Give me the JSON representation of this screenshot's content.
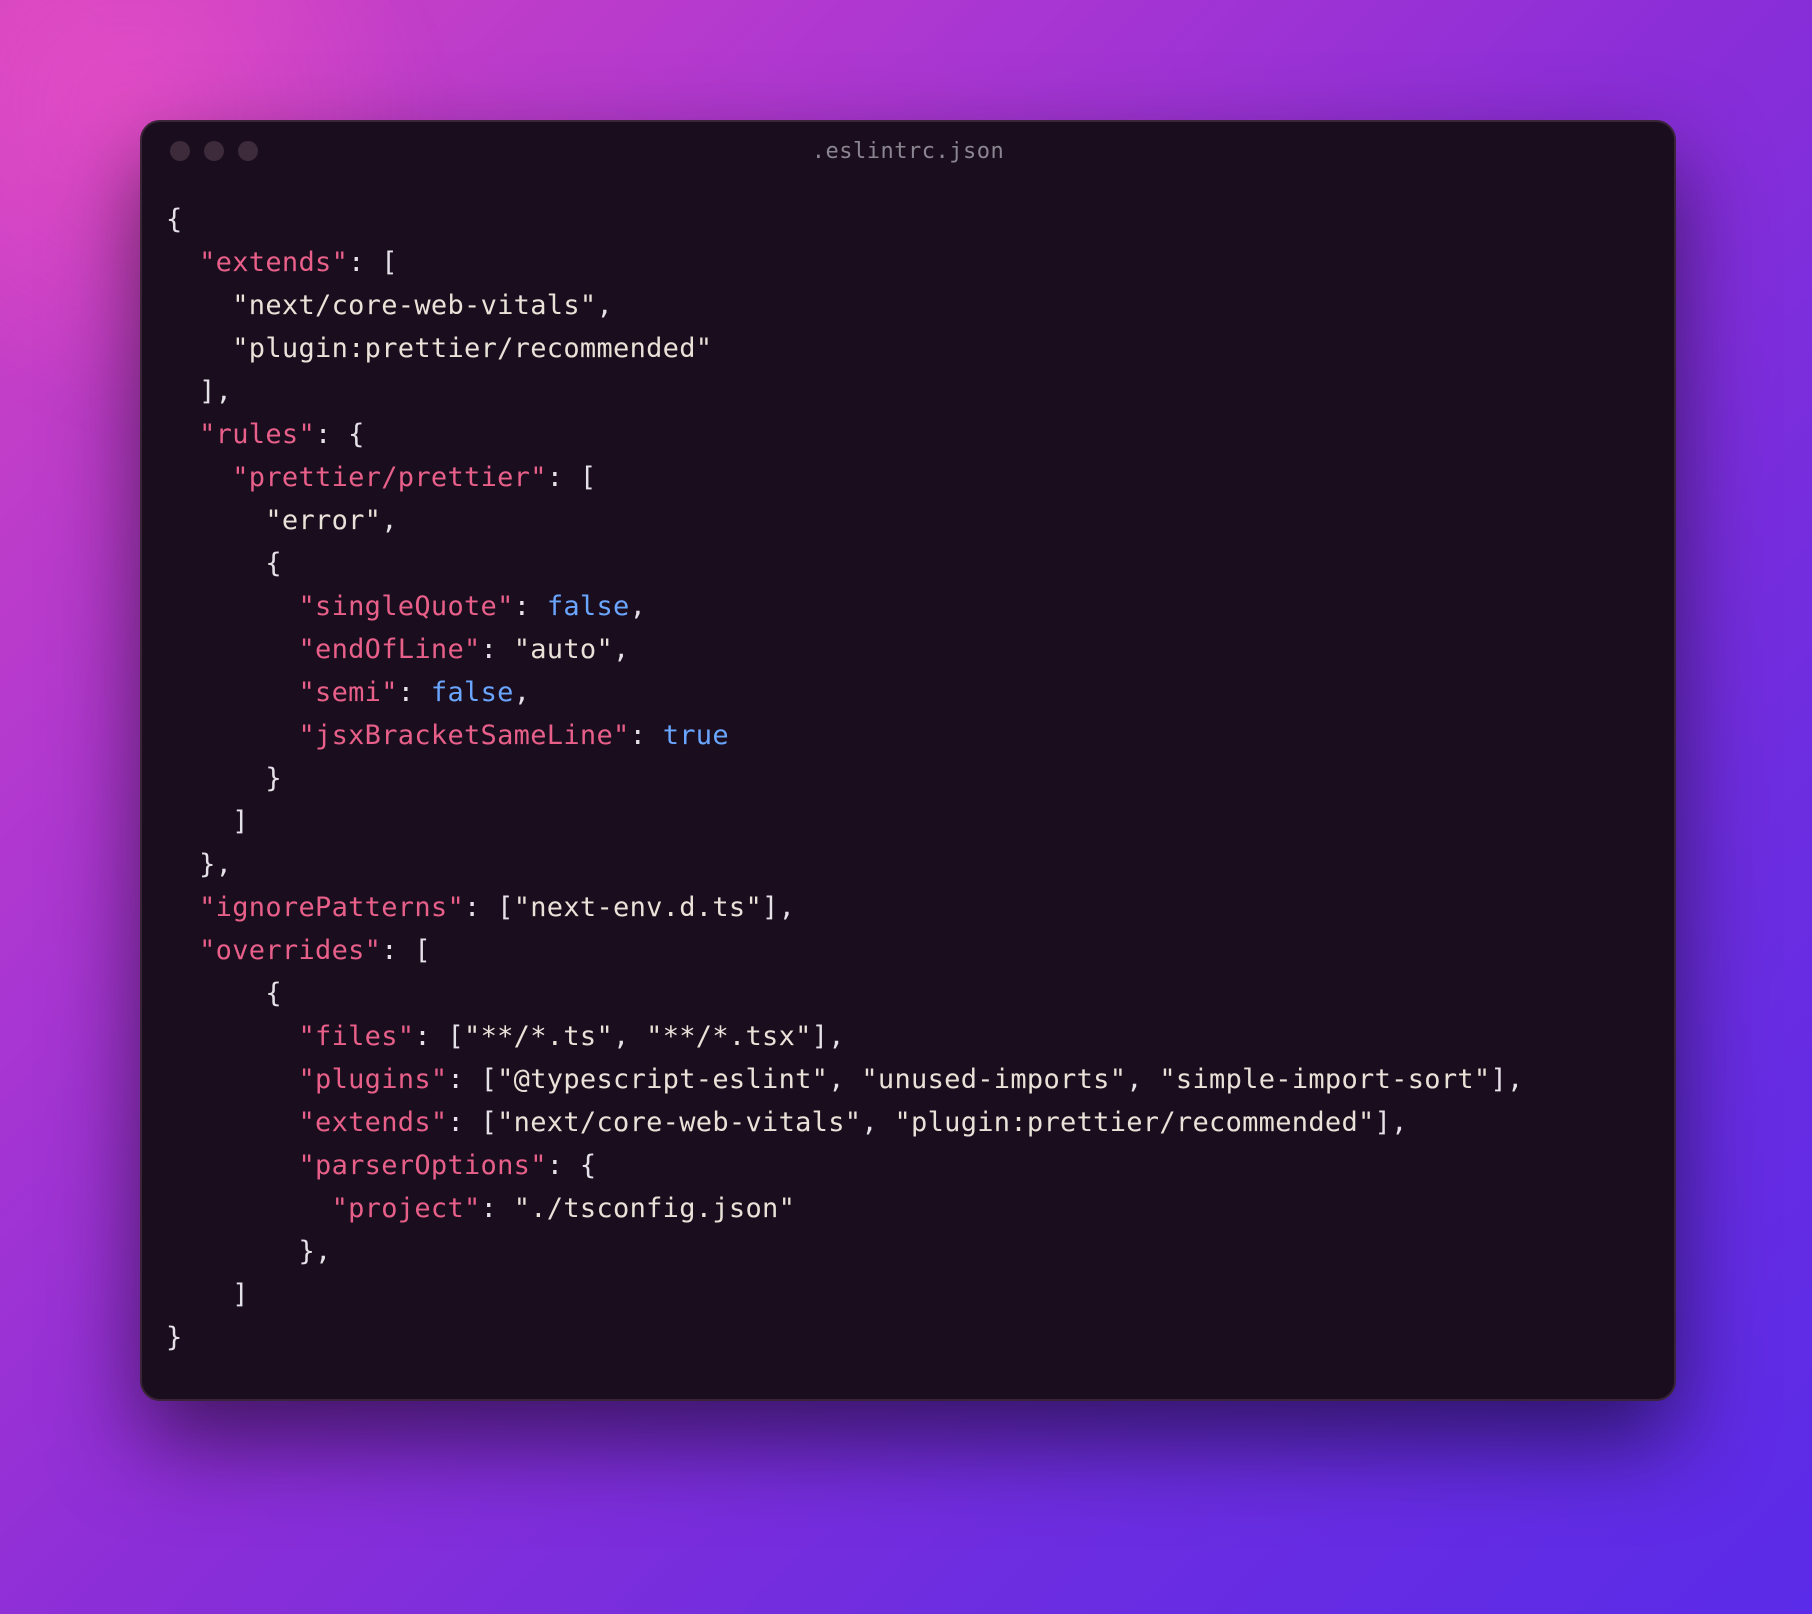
{
  "window": {
    "title": ".eslintrc.json"
  },
  "code": {
    "lines": [
      [
        [
          "punct",
          "{"
        ]
      ],
      [
        [
          "punct",
          "  "
        ],
        [
          "key",
          "\"extends\""
        ],
        [
          "punct",
          ": ["
        ]
      ],
      [
        [
          "punct",
          "    "
        ],
        [
          "str",
          "\"next/core-web-vitals\""
        ],
        [
          "punct",
          ","
        ]
      ],
      [
        [
          "punct",
          "    "
        ],
        [
          "str",
          "\"plugin:prettier/recommended\""
        ]
      ],
      [
        [
          "punct",
          "  ],"
        ]
      ],
      [
        [
          "punct",
          "  "
        ],
        [
          "key",
          "\"rules\""
        ],
        [
          "punct",
          ": {"
        ]
      ],
      [
        [
          "punct",
          "    "
        ],
        [
          "key",
          "\"prettier/prettier\""
        ],
        [
          "punct",
          ": ["
        ]
      ],
      [
        [
          "punct",
          "      "
        ],
        [
          "str",
          "\"error\""
        ],
        [
          "punct",
          ","
        ]
      ],
      [
        [
          "punct",
          "      {"
        ]
      ],
      [
        [
          "punct",
          "        "
        ],
        [
          "key",
          "\"singleQuote\""
        ],
        [
          "punct",
          ": "
        ],
        [
          "bool",
          "false"
        ],
        [
          "punct",
          ","
        ]
      ],
      [
        [
          "punct",
          "        "
        ],
        [
          "key",
          "\"endOfLine\""
        ],
        [
          "punct",
          ": "
        ],
        [
          "str",
          "\"auto\""
        ],
        [
          "punct",
          ","
        ]
      ],
      [
        [
          "punct",
          "        "
        ],
        [
          "key",
          "\"semi\""
        ],
        [
          "punct",
          ": "
        ],
        [
          "bool",
          "false"
        ],
        [
          "punct",
          ","
        ]
      ],
      [
        [
          "punct",
          "        "
        ],
        [
          "key",
          "\"jsxBracketSameLine\""
        ],
        [
          "punct",
          ": "
        ],
        [
          "bool",
          "true"
        ]
      ],
      [
        [
          "punct",
          "      }"
        ]
      ],
      [
        [
          "punct",
          "    ]"
        ]
      ],
      [
        [
          "punct",
          "  },"
        ]
      ],
      [
        [
          "punct",
          "  "
        ],
        [
          "key",
          "\"ignorePatterns\""
        ],
        [
          "punct",
          ": ["
        ],
        [
          "str",
          "\"next-env.d.ts\""
        ],
        [
          "punct",
          "],"
        ]
      ],
      [
        [
          "punct",
          "  "
        ],
        [
          "key",
          "\"overrides\""
        ],
        [
          "punct",
          ": ["
        ]
      ],
      [
        [
          "punct",
          "      {"
        ]
      ],
      [
        [
          "punct",
          "        "
        ],
        [
          "key",
          "\"files\""
        ],
        [
          "punct",
          ": ["
        ],
        [
          "str",
          "\"**/*.ts\""
        ],
        [
          "punct",
          ", "
        ],
        [
          "str",
          "\"**/*.tsx\""
        ],
        [
          "punct",
          "],"
        ]
      ],
      [
        [
          "punct",
          "        "
        ],
        [
          "key",
          "\"plugins\""
        ],
        [
          "punct",
          ": ["
        ],
        [
          "str",
          "\"@typescript-eslint\""
        ],
        [
          "punct",
          ", "
        ],
        [
          "str",
          "\"unused-imports\""
        ],
        [
          "punct",
          ", "
        ],
        [
          "str",
          "\"simple-import-sort\""
        ],
        [
          "punct",
          "],"
        ]
      ],
      [
        [
          "punct",
          "        "
        ],
        [
          "key",
          "\"extends\""
        ],
        [
          "punct",
          ": ["
        ],
        [
          "str",
          "\"next/core-web-vitals\""
        ],
        [
          "punct",
          ", "
        ],
        [
          "str",
          "\"plugin:prettier/recommended\""
        ],
        [
          "punct",
          "],"
        ]
      ],
      [
        [
          "punct",
          "        "
        ],
        [
          "key",
          "\"parserOptions\""
        ],
        [
          "punct",
          ": {"
        ]
      ],
      [
        [
          "punct",
          "          "
        ],
        [
          "key",
          "\"project\""
        ],
        [
          "punct",
          ": "
        ],
        [
          "str",
          "\"./tsconfig.json\""
        ]
      ],
      [
        [
          "punct",
          "        },"
        ]
      ],
      [
        [
          "punct",
          "    ]"
        ]
      ],
      [
        [
          "punct",
          "}"
        ]
      ]
    ]
  }
}
